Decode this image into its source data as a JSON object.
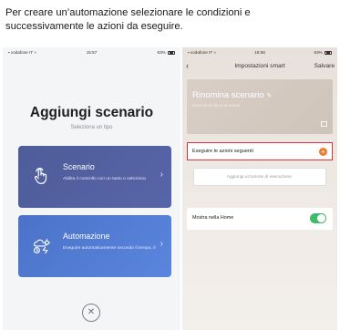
{
  "caption": {
    "line1": "Per creare un’automazione selezionare le condizioni e",
    "line2": "successivamente le azioni da eseguire."
  },
  "left_screen": {
    "status": {
      "carrier": "vodafone IT",
      "time": "15:57",
      "battery": "63%"
    },
    "title": "Aggiungi scenario",
    "subtitle": "Seleziona un tipo",
    "cards": [
      {
        "title": "Scenario",
        "description": "Abilita il controllo con un tasto o seleziona",
        "icon": "tap-hand-icon",
        "color": "#5462a2"
      },
      {
        "title": "Automazione",
        "description": "Eseguire automaticamente secondo il tempo, il",
        "icon": "weather-clock-icon",
        "color": "#5079d3"
      }
    ],
    "close_icon": "close-icon"
  },
  "right_screen": {
    "status": {
      "carrier": "vodafone IT",
      "time": "15:58",
      "battery": "63%"
    },
    "header": {
      "back_icon": "back-chevron-icon",
      "title": "Impostazioni smart",
      "save_label": "Salvare"
    },
    "hero": {
      "title": "Rinomina scenario",
      "subtitle": "Quando si clicca la scena"
    },
    "action_section": {
      "label": "Eseguire le azioni seguenti",
      "highlight_color": "#e0303a",
      "add_color": "#f07a2e"
    },
    "add_action_placeholder": "Aggiungi un'azione di esecuzione.",
    "show_home": {
      "label": "Mostra nella Home",
      "enabled": true,
      "toggle_color": "#3fb96a"
    }
  }
}
